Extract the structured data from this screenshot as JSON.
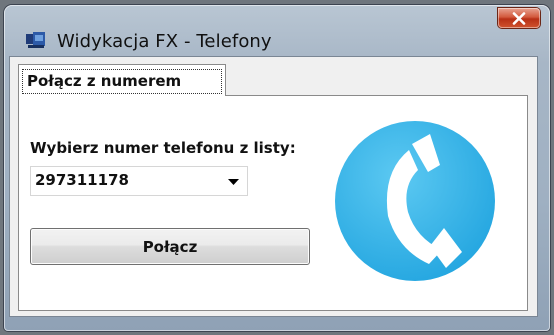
{
  "window": {
    "title": "Widykacja FX - Telefony"
  },
  "tabs": [
    {
      "label": "Połącz z numerem",
      "selected": true
    }
  ],
  "form": {
    "prompt_label": "Wybierz numer telefonu z  listy:",
    "phone_select_value": "297311178",
    "call_button_label": "Połącz"
  },
  "colors": {
    "logo_blue": "#35b3e8",
    "close_red": "#c9432a"
  },
  "icons": {
    "app": "app-icon",
    "close": "close-icon",
    "dropdown": "chevron-down-icon",
    "logo": "phone-handset-icon"
  }
}
